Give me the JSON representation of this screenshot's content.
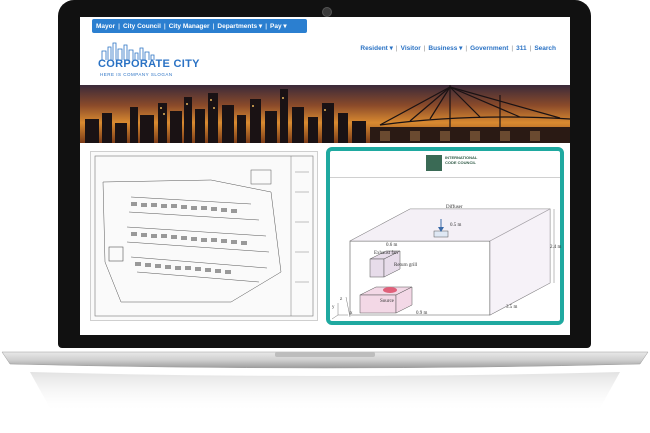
{
  "topnav": {
    "items": [
      "Mayor",
      "City Council",
      "City Manager",
      "Departments ▾",
      "Pay ▾"
    ]
  },
  "logo": {
    "title": "CORPORATE CITY",
    "tagline": "HERE IS COMPANY SLOGAN"
  },
  "mainnav": {
    "items": [
      "Resident ▾",
      "Visitor",
      "Business ▾",
      "Government",
      "311",
      "Search"
    ]
  },
  "diagram": {
    "org_name": "INTERNATIONAL CODE COUNCIL",
    "labels": {
      "exhaust_fan": "Exhaust fan",
      "diffuser": "Diffuser",
      "return_grill": "Return grill",
      "source": "Source",
      "dim_top": "0.5 m",
      "dim_fan": "0.6 m",
      "dim_height": "2.4 m",
      "dim_length": "3.5 m",
      "dim_bottom": "0.9 m",
      "axis_z": "z",
      "axis_y": "y",
      "axis_x": "x"
    }
  },
  "colors": {
    "accent_blue": "#2a72c4",
    "frame_teal": "#1fa9a0",
    "nav_bar": "#2b7fd0"
  }
}
